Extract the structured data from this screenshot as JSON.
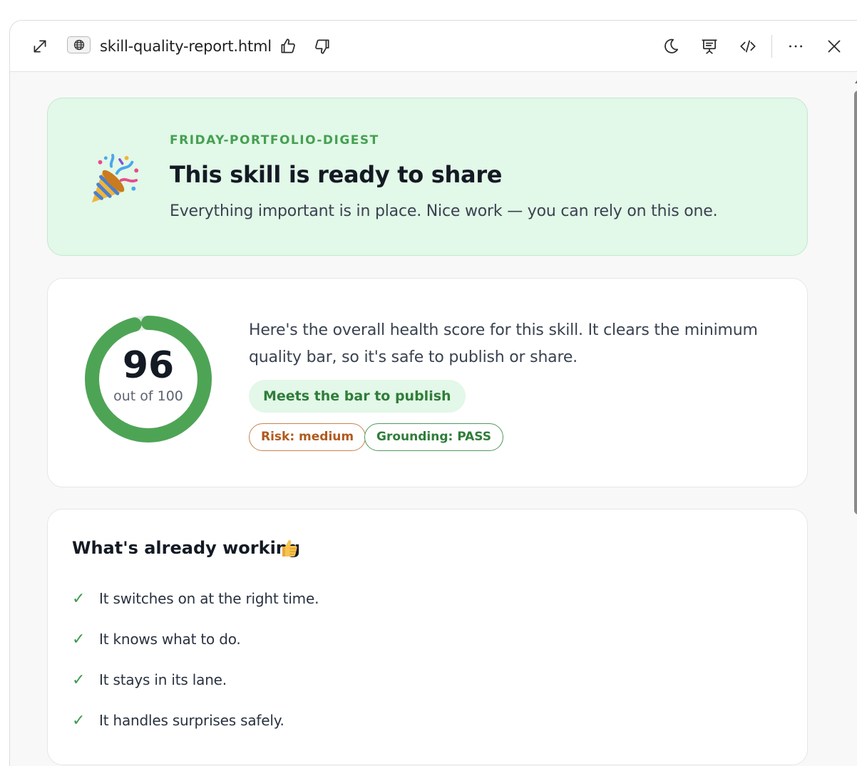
{
  "window": {
    "file_title": "skill-quality-report.html"
  },
  "hero": {
    "kicker": "FRIDAY-PORTFOLIO-DIGEST",
    "title": "This skill is ready to share",
    "subtitle": "Everything important is in place. Nice work — you can rely on this one.",
    "icon": "party-popper-icon",
    "bg_color": "#e2f8e8",
    "accent_color": "#45a052"
  },
  "score": {
    "value": "96",
    "caption": "out of 100",
    "fraction": 0.96,
    "ring_color": "#4ea455",
    "description": "Here's the overall health score for this skill. It clears the minimum quality bar, so it's safe to publish or share.",
    "badge": "Meets the bar to publish",
    "tags": {
      "risk": "Risk: medium",
      "grounding": "Grounding: PASS"
    }
  },
  "working": {
    "title": "What's already working",
    "icon": "thumbs-up-icon",
    "items": [
      "It switches on at the right time.",
      "It knows what to do.",
      "It stays in its lane.",
      "It handles surprises safely."
    ],
    "check_glyph": "✓"
  }
}
